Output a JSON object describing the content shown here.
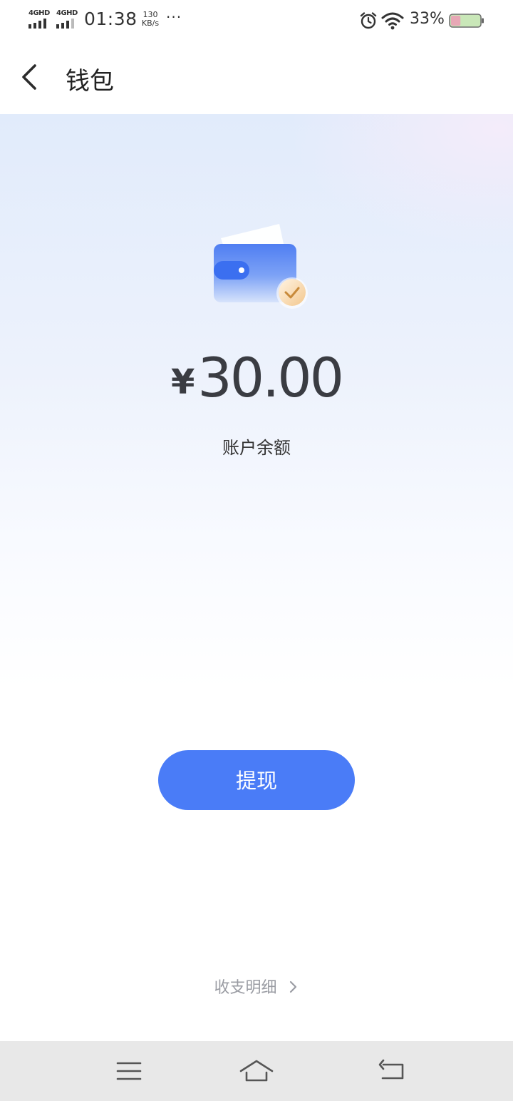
{
  "status_bar": {
    "network_1": "4GHD",
    "network_2": "4GHD",
    "time": "01:38",
    "speed_value": "130",
    "speed_unit": "KB/s",
    "more": "···",
    "battery_percent": "33%",
    "battery_level": 0.33
  },
  "header": {
    "title": "钱包"
  },
  "wallet": {
    "currency": "¥",
    "amount": "30.00",
    "balance_label": "账户余额"
  },
  "actions": {
    "withdraw_label": "提现",
    "details_label": "收支明细"
  },
  "icons": {
    "back": "chevron-left-icon",
    "alarm": "alarm-clock-icon",
    "wifi": "wifi-icon",
    "battery": "battery-icon",
    "wallet": "wallet-icon",
    "menu": "menu-icon",
    "home": "home-icon",
    "return": "return-icon"
  },
  "colors": {
    "accent": "#4a7cf7",
    "text_primary": "#3a3c42",
    "text_muted": "#9a9ca3",
    "nav_bg": "#e8e8e8"
  }
}
